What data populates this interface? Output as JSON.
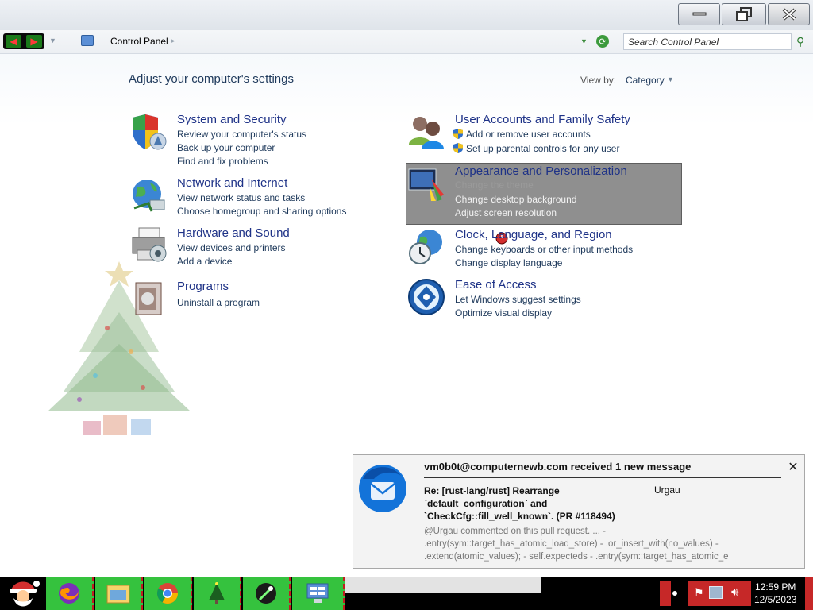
{
  "window": {
    "breadcrumb": "Control Panel",
    "search_placeholder": "Search Control Panel",
    "caption_buttons": [
      "minimize",
      "maximize",
      "close"
    ]
  },
  "main": {
    "title": "Adjust your computer's settings",
    "view_by_label": "View by:",
    "view_by_value": "Category"
  },
  "categories": [
    {
      "title": "System and Security",
      "icon": "shield-icon",
      "links": [
        "Review your computer's status",
        "Back up your computer",
        "Find and fix problems"
      ]
    },
    {
      "title": "Network and Internet",
      "icon": "globe-network-icon",
      "links": [
        "View network status and tasks",
        "Choose homegroup and sharing options"
      ]
    },
    {
      "title": "Hardware and Sound",
      "icon": "printer-icon",
      "links": [
        "View devices and printers",
        "Add a device"
      ]
    },
    {
      "title": "Programs",
      "icon": "programs-icon",
      "links": [
        "Uninstall a program"
      ]
    },
    {
      "title": "User Accounts and Family Safety",
      "icon": "users-icon",
      "links": [
        "Add or remove user accounts",
        "Set up parental controls for any user"
      ]
    },
    {
      "title": "Appearance and Personalization",
      "icon": "monitor-paint-icon",
      "links": [
        "Change the theme",
        "Change desktop background",
        "Adjust screen resolution"
      ],
      "highlighted": true
    },
    {
      "title": "Clock, Language, and Region",
      "icon": "clock-globe-icon",
      "links": [
        "Change keyboards or other input methods",
        "Change display language"
      ]
    },
    {
      "title": "Ease of Access",
      "icon": "ease-of-access-icon",
      "links": [
        "Let Windows suggest settings",
        "Optimize visual display"
      ]
    }
  ],
  "notification": {
    "sender": "vm0b0t@computernewb.com received 1 new message",
    "subject": "Re: [rust-lang/rust] Rearrange `default_configuration` and `CheckCfg::fill_well_known`. (PR #118494)",
    "author": "Urgau",
    "body": "@Urgau commented on this pull request. ... - .entry(sym::target_has_atomic_load_store) - .or_insert_with(no_values) - .extend(atomic_values); - self.expecteds - .entry(sym::target_has_atomic_e",
    "app_icon": "thunderbird-icon"
  },
  "taskbar": {
    "apps": [
      "firefox-icon",
      "file-explorer-icon",
      "chrome-icon",
      "christmas-tree-icon",
      "comet-icon",
      "control-panel-icon"
    ],
    "clock_time": "12:59 PM",
    "clock_date": "12/5/2023"
  },
  "colors": {
    "title_text": "#1e3287",
    "link_text": "#1e395b",
    "highlight": "#8f8f8f",
    "taskbar_app_bg": "#35c23e"
  }
}
